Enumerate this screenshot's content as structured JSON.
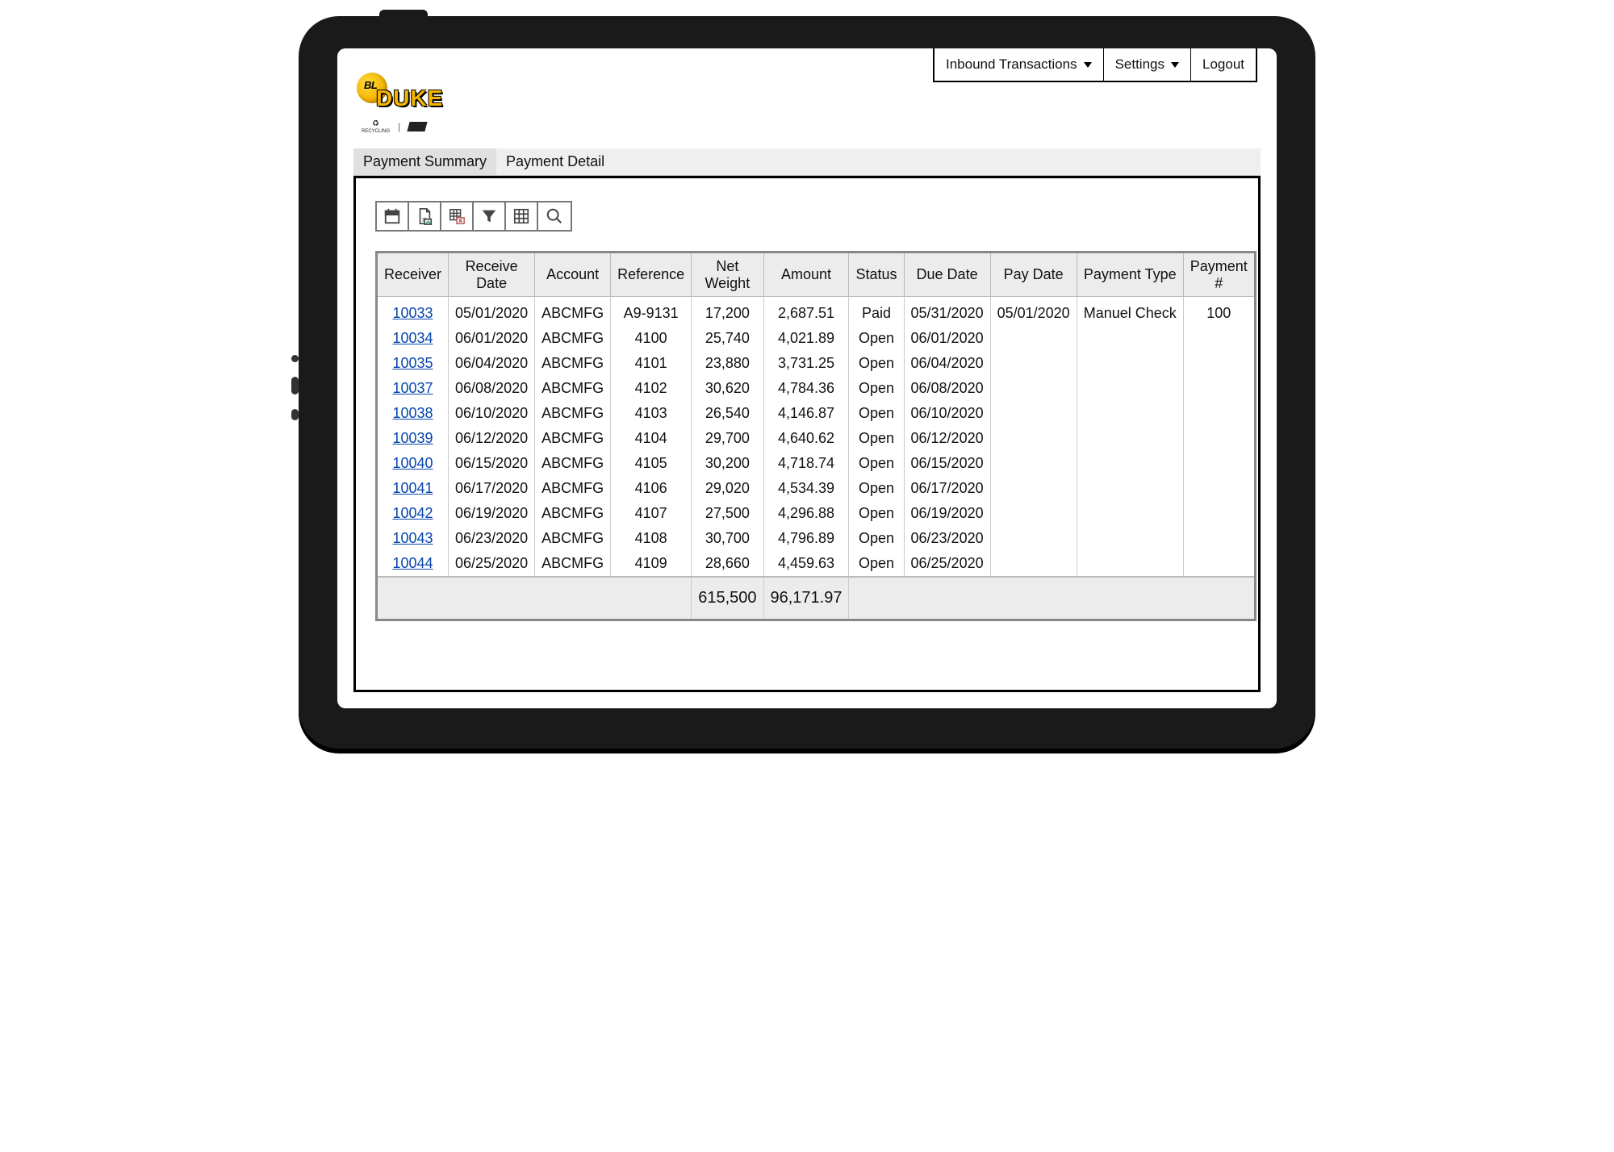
{
  "nav": {
    "inbound": "Inbound Transactions",
    "settings": "Settings",
    "logout": "Logout"
  },
  "logo": {
    "bl": "BL",
    "duke": "DUKE",
    "recycling": "RECYCLING"
  },
  "tabs": {
    "summary": "Payment Summary",
    "detail": "Payment Detail"
  },
  "columns": {
    "receiver": "Receiver",
    "receive_date": "Receive Date",
    "account": "Account",
    "reference": "Reference",
    "net_weight": "Net Weight",
    "amount": "Amount",
    "status": "Status",
    "due_date": "Due Date",
    "pay_date": "Pay Date",
    "payment_type": "Payment Type",
    "payment_no": "Payment #"
  },
  "rows": [
    {
      "receiver": "10033",
      "receive_date": "05/01/2020",
      "account": "ABCMFG",
      "reference": "A9-9131",
      "net_weight": "17,200",
      "amount": "2,687.51",
      "status": "Paid",
      "due_date": "05/31/2020",
      "pay_date": "05/01/2020",
      "payment_type": "Manuel Check",
      "payment_no": "100"
    },
    {
      "receiver": "10034",
      "receive_date": "06/01/2020",
      "account": "ABCMFG",
      "reference": "4100",
      "net_weight": "25,740",
      "amount": "4,021.89",
      "status": "Open",
      "due_date": "06/01/2020",
      "pay_date": "",
      "payment_type": "",
      "payment_no": ""
    },
    {
      "receiver": "10035",
      "receive_date": "06/04/2020",
      "account": "ABCMFG",
      "reference": "4101",
      "net_weight": "23,880",
      "amount": "3,731.25",
      "status": "Open",
      "due_date": "06/04/2020",
      "pay_date": "",
      "payment_type": "",
      "payment_no": ""
    },
    {
      "receiver": "10037",
      "receive_date": "06/08/2020",
      "account": "ABCMFG",
      "reference": "4102",
      "net_weight": "30,620",
      "amount": "4,784.36",
      "status": "Open",
      "due_date": "06/08/2020",
      "pay_date": "",
      "payment_type": "",
      "payment_no": ""
    },
    {
      "receiver": "10038",
      "receive_date": "06/10/2020",
      "account": "ABCMFG",
      "reference": "4103",
      "net_weight": "26,540",
      "amount": "4,146.87",
      "status": "Open",
      "due_date": "06/10/2020",
      "pay_date": "",
      "payment_type": "",
      "payment_no": ""
    },
    {
      "receiver": "10039",
      "receive_date": "06/12/2020",
      "account": "ABCMFG",
      "reference": "4104",
      "net_weight": "29,700",
      "amount": "4,640.62",
      "status": "Open",
      "due_date": "06/12/2020",
      "pay_date": "",
      "payment_type": "",
      "payment_no": ""
    },
    {
      "receiver": "10040",
      "receive_date": "06/15/2020",
      "account": "ABCMFG",
      "reference": "4105",
      "net_weight": "30,200",
      "amount": "4,718.74",
      "status": "Open",
      "due_date": "06/15/2020",
      "pay_date": "",
      "payment_type": "",
      "payment_no": ""
    },
    {
      "receiver": "10041",
      "receive_date": "06/17/2020",
      "account": "ABCMFG",
      "reference": "4106",
      "net_weight": "29,020",
      "amount": "4,534.39",
      "status": "Open",
      "due_date": "06/17/2020",
      "pay_date": "",
      "payment_type": "",
      "payment_no": ""
    },
    {
      "receiver": "10042",
      "receive_date": "06/19/2020",
      "account": "ABCMFG",
      "reference": "4107",
      "net_weight": "27,500",
      "amount": "4,296.88",
      "status": "Open",
      "due_date": "06/19/2020",
      "pay_date": "",
      "payment_type": "",
      "payment_no": ""
    },
    {
      "receiver": "10043",
      "receive_date": "06/23/2020",
      "account": "ABCMFG",
      "reference": "4108",
      "net_weight": "30,700",
      "amount": "4,796.89",
      "status": "Open",
      "due_date": "06/23/2020",
      "pay_date": "",
      "payment_type": "",
      "payment_no": ""
    },
    {
      "receiver": "10044",
      "receive_date": "06/25/2020",
      "account": "ABCMFG",
      "reference": "4109",
      "net_weight": "28,660",
      "amount": "4,459.63",
      "status": "Open",
      "due_date": "06/25/2020",
      "pay_date": "",
      "payment_type": "",
      "payment_no": ""
    }
  ],
  "totals": {
    "net_weight": "615,500",
    "amount": "96,171.97"
  }
}
